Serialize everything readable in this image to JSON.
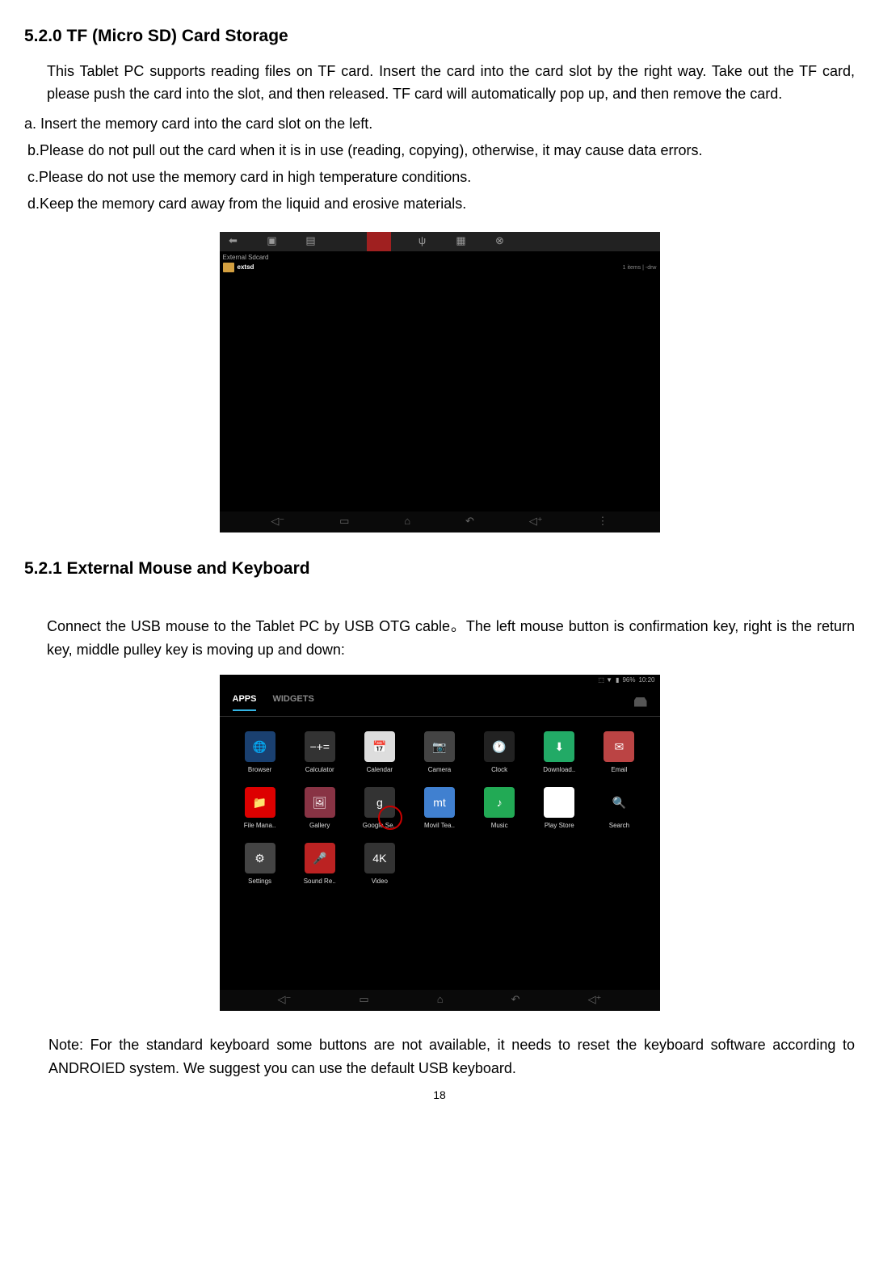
{
  "section520": {
    "title": "5.2.0 TF (Micro SD) Card Storage",
    "intro": "This Tablet PC supports reading files on TF card. Insert the card into the card slot by the right way. Take out the TF card, please push the card into the slot, and then released. TF card will automatically pop up, and then remove the card.",
    "item_a": "a.     Insert the memory card into the card slot on the left.",
    "item_b": "b.Please do not pull out the card when it is in use (reading, copying), otherwise, it may cause data errors.",
    "item_c": "c.Please do not use the memory card in high temperature conditions.",
    "item_d": "d.Keep the memory card away from the liquid and erosive materials."
  },
  "screenshot1": {
    "breadcrumb": "External Sdcard",
    "folder": "extsd",
    "info": "1 items | -drw"
  },
  "section521": {
    "title": "5.2.1 External Mouse and Keyboard",
    "intro": "Connect the USB mouse to the Tablet PC by USB OTG cable。The left mouse button is confirmation key, right is the return key, middle pulley key is moving up and down:"
  },
  "screenshot2": {
    "status_battery": "96%",
    "status_time": "10:20",
    "tab_apps": "APPS",
    "tab_widgets": "WIDGETS",
    "apps": [
      {
        "label": "Browser",
        "bg": "#1a4070",
        "glyph": "🌐"
      },
      {
        "label": "Calculator",
        "bg": "#333",
        "glyph": "−+="
      },
      {
        "label": "Calendar",
        "bg": "#ddd",
        "glyph": "📅"
      },
      {
        "label": "Camera",
        "bg": "#444",
        "glyph": "📷"
      },
      {
        "label": "Clock",
        "bg": "#222",
        "glyph": "🕐"
      },
      {
        "label": "Download..",
        "bg": "#2a6",
        "glyph": "⬇"
      },
      {
        "label": "Email",
        "bg": "#b44",
        "glyph": "✉"
      },
      {
        "label": "File Mana..",
        "bg": "#d00",
        "glyph": "📁"
      },
      {
        "label": "Gallery",
        "bg": "#834",
        "glyph": "🖼"
      },
      {
        "label": "Google Se..",
        "bg": "#333",
        "glyph": "g"
      },
      {
        "label": "Movil Tea..",
        "bg": "#4080d0",
        "glyph": "mt"
      },
      {
        "label": "Music",
        "bg": "#2a5",
        "glyph": "♪"
      },
      {
        "label": "Play Store",
        "bg": "#fff",
        "glyph": "▶"
      },
      {
        "label": "Search",
        "bg": "transparent",
        "glyph": "🔍"
      },
      {
        "label": "Settings",
        "bg": "#444",
        "glyph": "⚙"
      },
      {
        "label": "Sound Re..",
        "bg": "#b22",
        "glyph": "🎤"
      },
      {
        "label": "Video",
        "bg": "#333",
        "glyph": "4K"
      }
    ]
  },
  "note": "Note: For the standard keyboard some buttons are not available, it needs to reset the keyboard software according to ANDROIED system. We suggest you can use the default USB keyboard.",
  "page_number": "18"
}
